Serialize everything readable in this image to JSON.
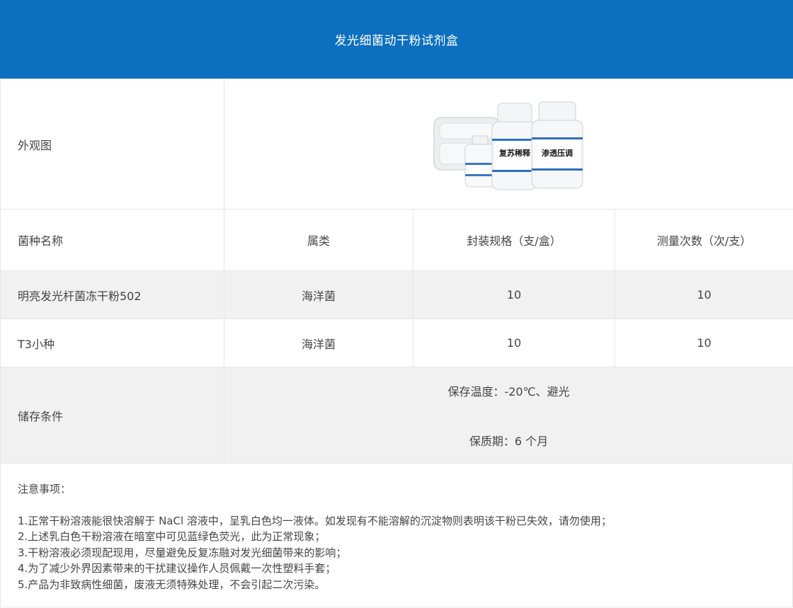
{
  "header": {
    "title": "发光细菌动干粉试剂盒"
  },
  "appearance": {
    "label": "外观图",
    "bottle_large_1_label": "复苏稀释",
    "bottle_large_2_label": "渗透压调"
  },
  "columns": {
    "name": "菌种名称",
    "genus": "属类",
    "package": "封装规格（支/盒）",
    "measure": "测量次数（次/支）"
  },
  "rows": [
    {
      "name": "明亮发光杆菌冻干粉502",
      "genus": "海洋菌",
      "package": "10",
      "measure": "10"
    },
    {
      "name": "T3小种",
      "genus": "海洋菌",
      "package": "10",
      "measure": "10"
    }
  ],
  "storage": {
    "label": "储存条件",
    "temperature": "保存温度：-20℃、避光",
    "shelf_life": "保质期：6 个月"
  },
  "notes": {
    "title": "注意事项：",
    "items": [
      "1.正常干粉溶液能很快溶解于 NaCl 溶液中，呈乳白色均一液体。如发现有不能溶解的沉淀物则表明该干粉已失效，请勿使用；",
      "2.上述乳白色干粉溶液在暗室中可见蓝绿色荧光，此为正常现象；",
      "3.干粉溶液必须现配现用，尽量避免反复冻融对发光细菌带来的影响；",
      "4.为了减少外界因素带来的干扰建议操作人员佩戴一次性塑料手套；",
      "5.产品为非致病性细菌，废液无须特殊处理，不会引起二次污染。"
    ]
  },
  "colors": {
    "header_bg": "#0c6fc0",
    "row_alt_bg": "#f1f1f1",
    "border": "#e6e6e6",
    "text": "#454545"
  }
}
